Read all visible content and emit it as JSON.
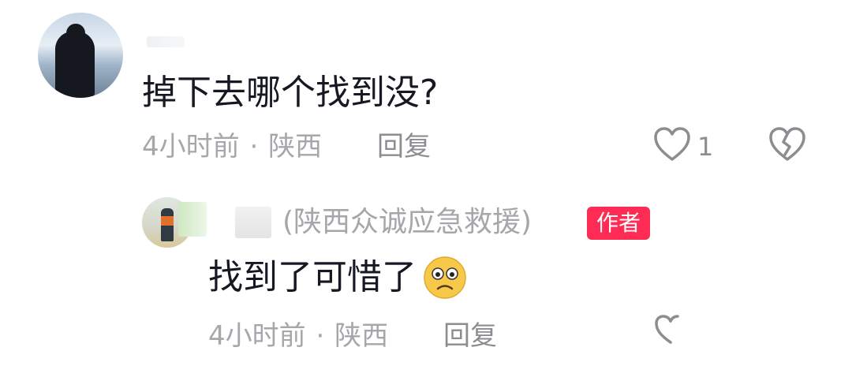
{
  "comment": {
    "text": "掉下去哪个找到没?",
    "time": "4小时前",
    "separator": "·",
    "location": "陕西",
    "reply_label": "回复",
    "like_count": "1",
    "icons": {
      "like": "heart-outline-icon",
      "dislike": "broken-heart-icon"
    }
  },
  "reply": {
    "author_name": "(陕西众诚应急救援)",
    "badge": "作者",
    "text": "找到了可惜了",
    "emoji": "worried-face-emoji",
    "time": "4小时前",
    "separator": "·",
    "location": "陕西",
    "reply_label": "回复"
  },
  "colors": {
    "badge": "#fe2c55",
    "text_primary": "#161823",
    "text_secondary": "#a5a7ab"
  }
}
